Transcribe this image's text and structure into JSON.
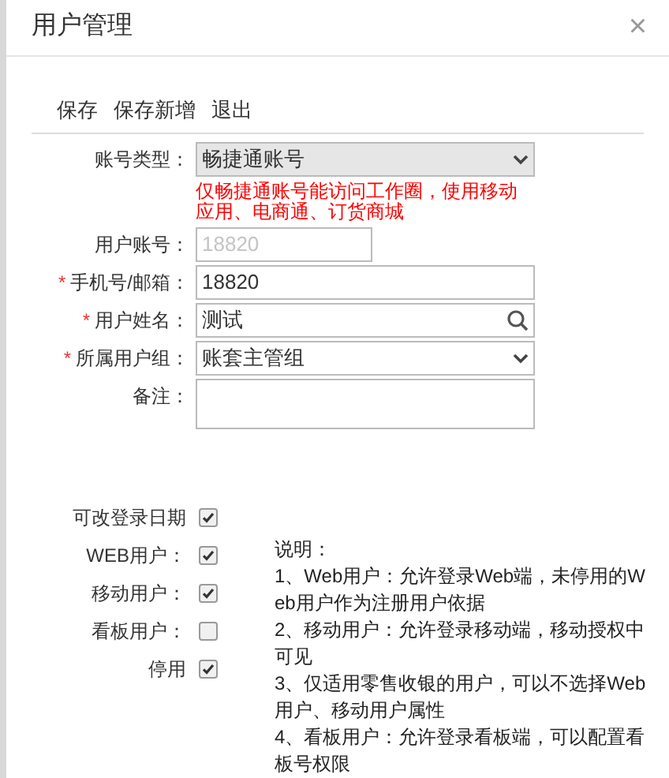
{
  "dialog": {
    "title": "用户管理",
    "close": "×"
  },
  "toolbar": [
    "保存",
    "保存新增",
    "退出"
  ],
  "fields": [
    {
      "kind": "select",
      "label": "账号类型：",
      "value": "畅捷通账号",
      "disabled": true,
      "note": "仅畅捷通账号能访问工作圈，使用移动应用、电商通、订货商城"
    },
    {
      "kind": "short_text",
      "label": "用户账号：",
      "value": "18820",
      "disabled": true
    },
    {
      "kind": "text",
      "label": "手机号/邮箱：",
      "required_mark": "*",
      "value": "18820",
      "disabled": false
    },
    {
      "kind": "search",
      "label": "用户姓名：",
      "required_mark": "*",
      "value": "测试"
    },
    {
      "kind": "select",
      "label": "所属用户组：",
      "required_mark": "*",
      "value": "账套主管组",
      "disabled": false
    },
    {
      "kind": "textarea",
      "label": "备注："
    }
  ],
  "options": [
    {
      "label": "可改登录日期",
      "checked": true
    },
    {
      "label": "WEB用户：",
      "checked": true
    },
    {
      "label": "移动用户：",
      "checked": true
    },
    {
      "label": "看板用户：",
      "checked": false
    },
    {
      "label": "停用",
      "checked": true
    }
  ],
  "notes": {
    "title": "说明：",
    "items": [
      "1、Web用户：允许登录Web端，未停用的Web用户作为注册用户依据",
      "2、移动用户：允许登录移动端，移动授权中可见",
      "3、仅适用零售收银的用户，可以不选择Web用户、移动用户属性",
      "4、看板用户：允许登录看板端，可以配置看板号权限"
    ]
  }
}
